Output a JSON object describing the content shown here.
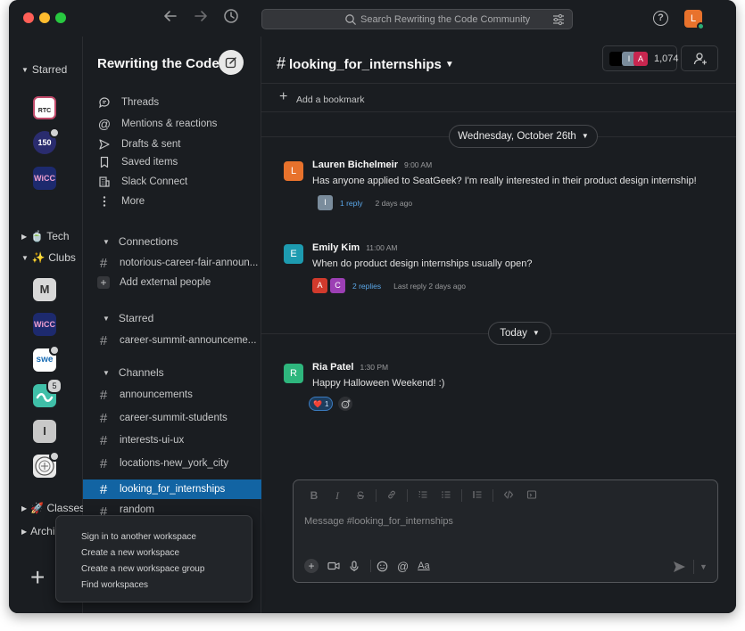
{
  "titlebar": {
    "search_placeholder": "Search Rewriting the Code Community",
    "user_initial": "L"
  },
  "rail": {
    "sections": [
      {
        "label": "Starred"
      },
      {
        "label": "Tech",
        "emoji": "🍵"
      },
      {
        "label": "Clubs",
        "emoji": "✨"
      },
      {
        "label": "Classes",
        "emoji": "🚀"
      },
      {
        "label": "Archi"
      }
    ],
    "workspaces": [
      {
        "label": "RTC"
      },
      {
        "label": "150"
      },
      {
        "label": "WiCC"
      },
      {
        "label": "M"
      },
      {
        "label": "WiCC"
      },
      {
        "label": "swe"
      },
      {
        "label": "",
        "badge": "5"
      },
      {
        "label": "I"
      },
      {
        "label": ""
      }
    ]
  },
  "sidebar": {
    "workspace_name": "Rewriting the Code",
    "nav": [
      {
        "label": "Threads",
        "icon": "threads-icon"
      },
      {
        "label": "Mentions & reactions",
        "icon": "at-icon"
      },
      {
        "label": "Drafts & sent",
        "icon": "send-icon"
      },
      {
        "label": "Saved items",
        "icon": "bookmark-icon"
      },
      {
        "label": "Slack Connect",
        "icon": "building-icon"
      },
      {
        "label": "More",
        "icon": "more-vertical-icon"
      }
    ],
    "connections": {
      "title": "Connections",
      "channels": [
        "notorious-career-fair-announ..."
      ],
      "add_label": "Add external people"
    },
    "starred": {
      "title": "Starred",
      "channels": [
        "career-summit-announceme..."
      ]
    },
    "channels": {
      "title": "Channels",
      "items": [
        "announcements",
        "career-summit-students",
        "interests-ui-ux",
        "locations-new_york_city",
        "looking_for_internships",
        "random"
      ],
      "active": "looking_for_internships"
    }
  },
  "main": {
    "channel_name": "looking_for_internships",
    "member_count": "1,074",
    "member_avatars": [
      {
        "initial": "",
        "color": "#000000"
      },
      {
        "initial": "I",
        "color": "#7a8c9c"
      },
      {
        "initial": "A",
        "color": "#c8264f"
      }
    ],
    "bookmark_label": "Add a bookmark",
    "date_1": "Wednesday, October 26th",
    "date_2": "Today",
    "messages": [
      {
        "initial": "L",
        "color": "#e8722c",
        "name": "Lauren Bichelmeir",
        "time": "9:00 AM",
        "text": "Has anyone applied to SeatGeek? I'm really interested in their product design internship!",
        "thread": {
          "avatars": [
            {
              "initial": "I",
              "color": "#7a8c9c"
            }
          ],
          "replies": "1 reply",
          "last": "2 days ago"
        }
      },
      {
        "initial": "E",
        "color": "#1d9bb0",
        "name": "Emily Kim",
        "time": "11:00 AM",
        "text": "When do product design internships usually open?",
        "thread": {
          "avatars": [
            {
              "initial": "A",
              "color": "#d13a2c"
            },
            {
              "initial": "C",
              "color": "#9c3fb4"
            }
          ],
          "replies": "2 replies",
          "last": "Last reply 2 days ago"
        }
      },
      {
        "initial": "R",
        "color": "#2eb67d",
        "name": "Ria Patel",
        "time": "1:30 PM",
        "text": "Happy Halloween Weekend! :)",
        "reaction": {
          "emoji": "❤️",
          "count": "1"
        }
      }
    ],
    "composer": {
      "placeholder": "Message #looking_for_internships",
      "format_label": "Aa"
    }
  },
  "popup": {
    "items": [
      "Sign in to another workspace",
      "Create a new workspace",
      "Create a new workspace group",
      "Find workspaces"
    ]
  }
}
